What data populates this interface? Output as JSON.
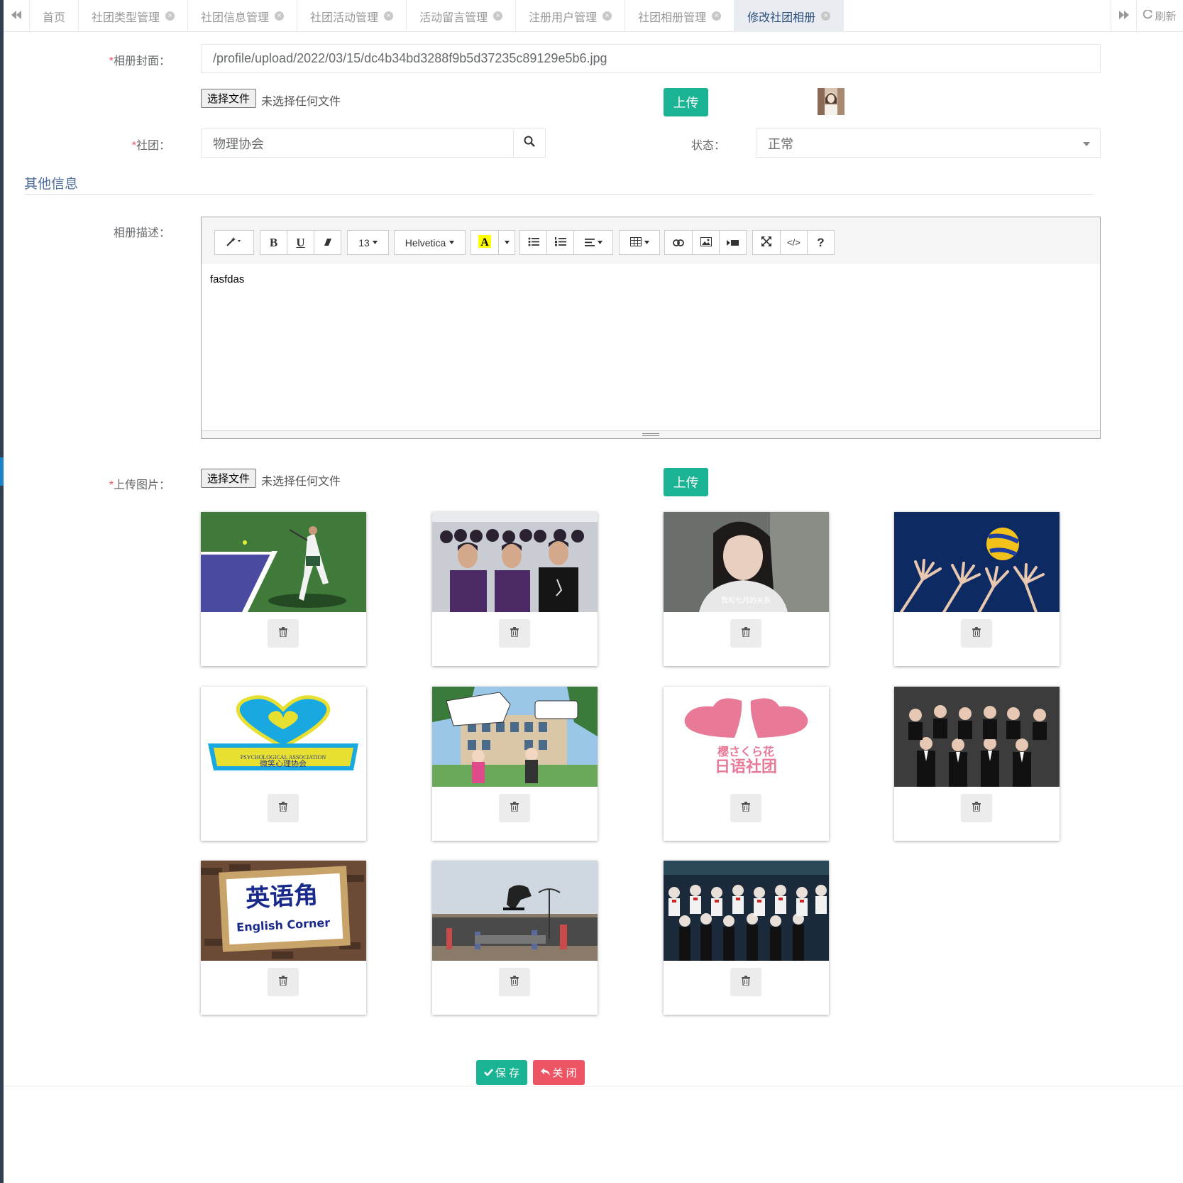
{
  "tabs": [
    {
      "label": "首页",
      "closable": false,
      "active": false
    },
    {
      "label": "社团类型管理",
      "closable": true,
      "active": false
    },
    {
      "label": "社团信息管理",
      "closable": true,
      "active": false
    },
    {
      "label": "社团活动管理",
      "closable": true,
      "active": false
    },
    {
      "label": "活动留言管理",
      "closable": true,
      "active": false
    },
    {
      "label": "注册用户管理",
      "closable": true,
      "active": false
    },
    {
      "label": "社团相册管理",
      "closable": true,
      "active": false
    },
    {
      "label": "修改社团相册",
      "closable": true,
      "active": true
    }
  ],
  "refresh_label": "刷新",
  "form": {
    "cover_label": "相册封面：",
    "cover_value": "/profile/upload/2022/03/15/dc4b34bd3288f9b5d37235c89129e5b6.jpg",
    "choose_file": "选择文件",
    "no_file": "未选择任何文件",
    "upload": "上传",
    "club_label": "社团：",
    "club_value": "物理协会",
    "status_label": "状态：",
    "status_value": "正常",
    "section_title": "其他信息",
    "desc_label": "相册描述：",
    "desc_value": "fasfdas",
    "images_label": "上传图片：",
    "required_mark": "*"
  },
  "editor_toolbar": {
    "font_size": "13",
    "font_name": "Helvetica",
    "bold": "B",
    "underline": "U",
    "help": "?",
    "code": "</>"
  },
  "image_cards": [
    {
      "name": "tennis"
    },
    {
      "name": "children"
    },
    {
      "name": "girl"
    },
    {
      "name": "volleyball"
    },
    {
      "name": "psych-association"
    },
    {
      "name": "comic"
    },
    {
      "name": "japanese-club"
    },
    {
      "name": "group-photo"
    },
    {
      "name": "english-corner"
    },
    {
      "name": "skateboard"
    },
    {
      "name": "choir"
    }
  ],
  "image_texts": {
    "girl_caption": "我和七月的关系",
    "psych_en": "PSYCHOLOGICAL ASSOCIATION",
    "psych_cn": "微笑心理协会",
    "jp_top": "樱さくら花",
    "jp_bottom": "日语社团",
    "english_cn": "英语角",
    "english_en": "English Corner"
  },
  "actions": {
    "save": "保 存",
    "close": "关 闭"
  },
  "colors": {
    "primary": "#1ab394",
    "danger": "#ed5565",
    "tab_active_bg": "#e9edf2",
    "section_title": "#4e6e9c"
  }
}
